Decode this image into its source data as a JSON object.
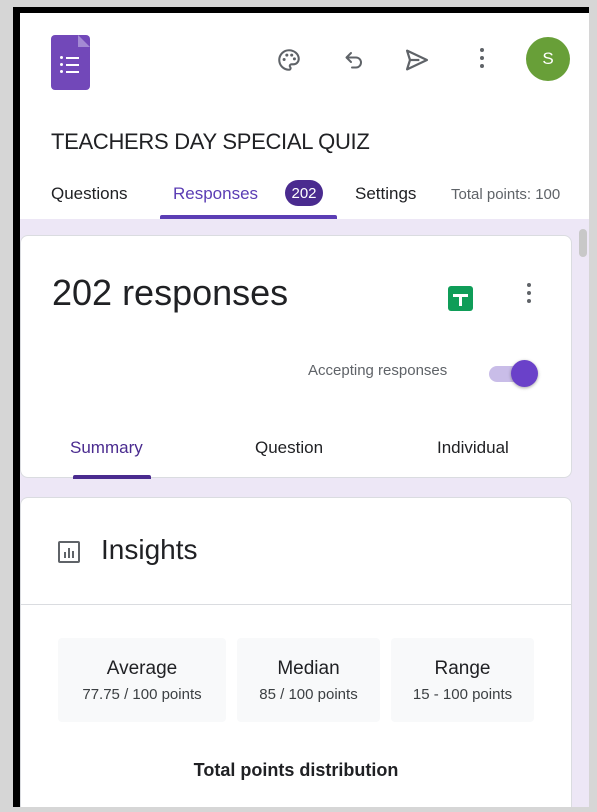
{
  "header": {
    "form_title": "TEACHERS DAY SPECIAL QUIZ",
    "avatar_initial": "S"
  },
  "tabs": {
    "questions": "Questions",
    "responses": "Responses",
    "responses_count": "202",
    "settings": "Settings",
    "total_points": "Total points: 100"
  },
  "responses_card": {
    "title": "202 responses",
    "accepting_label": "Accepting responses",
    "accepting_on": true,
    "subtabs": {
      "summary": "Summary",
      "question": "Question",
      "individual": "Individual"
    }
  },
  "insights": {
    "title": "Insights",
    "stats": [
      {
        "label": "Average",
        "value": "77.75 / 100 points"
      },
      {
        "label": "Median",
        "value": "85 / 100 points"
      },
      {
        "label": "Range",
        "value": "15 - 100 points"
      }
    ],
    "distribution_title": "Total points distribution"
  },
  "colors": {
    "accent": "#5b3db4",
    "badge": "#4a2b8f",
    "background": "#ede7f6",
    "avatar": "#689f38",
    "sheets": "#0f9d58"
  },
  "icons": [
    "forms-logo-icon",
    "palette-icon",
    "undo-icon",
    "send-icon",
    "more-vert-icon",
    "sheets-icon",
    "insights-chart-icon"
  ]
}
